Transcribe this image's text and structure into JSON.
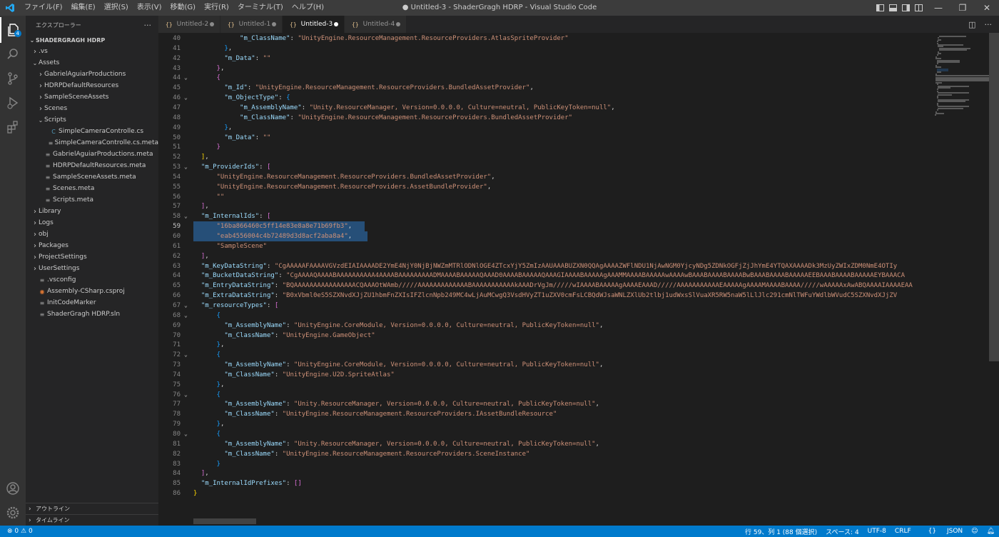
{
  "menu": [
    "ファイル(F)",
    "編集(E)",
    "選択(S)",
    "表示(V)",
    "移動(G)",
    "実行(R)",
    "ターミナル(T)",
    "ヘルプ(H)"
  ],
  "window_title": "● Untitled-3 - ShaderGragh HDRP - Visual Studio Code",
  "activity": {
    "explorer_badge": "4"
  },
  "sidebar": {
    "title": "エクスプローラー",
    "more": "···",
    "workspace": "SHADERGRAGH HDRP",
    "tree": [
      {
        "label": ".vs",
        "depth": 0,
        "kind": "folder",
        "open": false
      },
      {
        "label": "Assets",
        "depth": 0,
        "kind": "folder",
        "open": true
      },
      {
        "label": "GabrielAguiarProductions",
        "depth": 1,
        "kind": "folder",
        "open": false
      },
      {
        "label": "HDRPDefaultResources",
        "depth": 1,
        "kind": "folder",
        "open": false
      },
      {
        "label": "SampleSceneAssets",
        "depth": 1,
        "kind": "folder",
        "open": false
      },
      {
        "label": "Scenes",
        "depth": 1,
        "kind": "folder",
        "open": false
      },
      {
        "label": "Scripts",
        "depth": 1,
        "kind": "folder",
        "open": true
      },
      {
        "label": "SimpleCameraControlle.cs",
        "depth": 2,
        "kind": "cs"
      },
      {
        "label": "SimpleCameraControlle.cs.meta",
        "depth": 2,
        "kind": "meta"
      },
      {
        "label": "GabrielAguiarProductions.meta",
        "depth": 1,
        "kind": "meta"
      },
      {
        "label": "HDRPDefaultResources.meta",
        "depth": 1,
        "kind": "meta"
      },
      {
        "label": "SampleSceneAssets.meta",
        "depth": 1,
        "kind": "meta"
      },
      {
        "label": "Scenes.meta",
        "depth": 1,
        "kind": "meta"
      },
      {
        "label": "Scripts.meta",
        "depth": 1,
        "kind": "meta"
      },
      {
        "label": "Library",
        "depth": 0,
        "kind": "folder",
        "open": false
      },
      {
        "label": "Logs",
        "depth": 0,
        "kind": "folder",
        "open": false
      },
      {
        "label": "obj",
        "depth": 0,
        "kind": "folder",
        "open": false
      },
      {
        "label": "Packages",
        "depth": 0,
        "kind": "folder",
        "open": false
      },
      {
        "label": "ProjectSettings",
        "depth": 0,
        "kind": "folder",
        "open": false
      },
      {
        "label": "UserSettings",
        "depth": 0,
        "kind": "folder",
        "open": false
      },
      {
        "label": ".vsconfig",
        "depth": 0,
        "kind": "meta"
      },
      {
        "label": "Assembly-CSharp.csproj",
        "depth": 0,
        "kind": "rss"
      },
      {
        "label": "InitCodeMarker",
        "depth": 0,
        "kind": "meta"
      },
      {
        "label": "ShaderGragh HDRP.sln",
        "depth": 0,
        "kind": "meta"
      }
    ],
    "outline": "アウトライン",
    "timeline": "タイムライン"
  },
  "tabs": [
    {
      "label": "Untitled-2",
      "active": false
    },
    {
      "label": "Untitled-1",
      "active": false
    },
    {
      "label": "Untitled-3",
      "active": true
    },
    {
      "label": "Untitled-4",
      "active": false
    }
  ],
  "editor": {
    "lines": [
      {
        "n": "40",
        "fold": "",
        "t": [
          [
            "            ",
            "p"
          ],
          [
            "\"m_ClassName\"",
            "k"
          ],
          [
            ": ",
            "p"
          ],
          [
            "\"UnityEngine.ResourceManagement.ResourceProviders.AtlasSpriteProvider\"",
            "s"
          ]
        ]
      },
      {
        "n": "41",
        "fold": "",
        "t": [
          [
            "        ",
            "p"
          ],
          [
            "}",
            "b3"
          ],
          [
            ",",
            "p"
          ]
        ]
      },
      {
        "n": "42",
        "fold": "",
        "t": [
          [
            "        ",
            "p"
          ],
          [
            "\"m_Data\"",
            "k"
          ],
          [
            ": ",
            "p"
          ],
          [
            "\"\"",
            "s"
          ]
        ]
      },
      {
        "n": "43",
        "fold": "",
        "t": [
          [
            "      ",
            "p"
          ],
          [
            "}",
            "b2"
          ],
          [
            ",",
            "p"
          ]
        ]
      },
      {
        "n": "44",
        "fold": "v",
        "t": [
          [
            "      ",
            "p"
          ],
          [
            "{",
            "b2"
          ]
        ]
      },
      {
        "n": "45",
        "fold": "",
        "t": [
          [
            "        ",
            "p"
          ],
          [
            "\"m_Id\"",
            "k"
          ],
          [
            ": ",
            "p"
          ],
          [
            "\"UnityEngine.ResourceManagement.ResourceProviders.BundledAssetProvider\"",
            "s"
          ],
          [
            ",",
            "p"
          ]
        ]
      },
      {
        "n": "46",
        "fold": "v",
        "t": [
          [
            "        ",
            "p"
          ],
          [
            "\"m_ObjectType\"",
            "k"
          ],
          [
            ": ",
            "p"
          ],
          [
            "{",
            "b3"
          ]
        ]
      },
      {
        "n": "47",
        "fold": "",
        "t": [
          [
            "            ",
            "p"
          ],
          [
            "\"m_AssemblyName\"",
            "k"
          ],
          [
            ": ",
            "p"
          ],
          [
            "\"Unity.ResourceManager, Version=0.0.0.0, Culture=neutral, PublicKeyToken=null\"",
            "s"
          ],
          [
            ",",
            "p"
          ]
        ]
      },
      {
        "n": "48",
        "fold": "",
        "t": [
          [
            "            ",
            "p"
          ],
          [
            "\"m_ClassName\"",
            "k"
          ],
          [
            ": ",
            "p"
          ],
          [
            "\"UnityEngine.ResourceManagement.ResourceProviders.BundledAssetProvider\"",
            "s"
          ]
        ]
      },
      {
        "n": "49",
        "fold": "",
        "t": [
          [
            "        ",
            "p"
          ],
          [
            "}",
            "b3"
          ],
          [
            ",",
            "p"
          ]
        ]
      },
      {
        "n": "50",
        "fold": "",
        "t": [
          [
            "        ",
            "p"
          ],
          [
            "\"m_Data\"",
            "k"
          ],
          [
            ": ",
            "p"
          ],
          [
            "\"\"",
            "s"
          ]
        ]
      },
      {
        "n": "51",
        "fold": "",
        "t": [
          [
            "      ",
            "p"
          ],
          [
            "}",
            "b2"
          ]
        ]
      },
      {
        "n": "52",
        "fold": "",
        "t": [
          [
            "  ",
            "p"
          ],
          [
            "]",
            "b1"
          ],
          [
            ",",
            "p"
          ]
        ]
      },
      {
        "n": "53",
        "fold": "v",
        "t": [
          [
            "  ",
            "p"
          ],
          [
            "\"m_ProviderIds\"",
            "k"
          ],
          [
            ": ",
            "p"
          ],
          [
            "[",
            "b2"
          ]
        ]
      },
      {
        "n": "54",
        "fold": "",
        "t": [
          [
            "      ",
            "p"
          ],
          [
            "\"UnityEngine.ResourceManagement.ResourceProviders.BundledAssetProvider\"",
            "s"
          ],
          [
            ",",
            "p"
          ]
        ]
      },
      {
        "n": "55",
        "fold": "",
        "t": [
          [
            "      ",
            "p"
          ],
          [
            "\"UnityEngine.ResourceManagement.ResourceProviders.AssetBundleProvider\"",
            "s"
          ],
          [
            ",",
            "p"
          ]
        ]
      },
      {
        "n": "56",
        "fold": "",
        "t": [
          [
            "      ",
            "p"
          ],
          [
            "\"\"",
            "s"
          ]
        ]
      },
      {
        "n": "57",
        "fold": "",
        "t": [
          [
            "  ",
            "p"
          ],
          [
            "]",
            "b2"
          ],
          [
            ",",
            "p"
          ]
        ]
      },
      {
        "n": "58",
        "fold": "v",
        "t": [
          [
            "  ",
            "p"
          ],
          [
            "\"m_InternalIds\"",
            "k"
          ],
          [
            ": ",
            "p"
          ],
          [
            "[",
            "b2"
          ]
        ]
      },
      {
        "n": "59",
        "fold": "",
        "sel": true,
        "cur": true,
        "t": [
          [
            "      ",
            "p"
          ],
          [
            "\"16ba866460c5ff14e83e8a8e71b69fb3\"",
            "s"
          ],
          [
            ",",
            "p"
          ]
        ]
      },
      {
        "n": "60",
        "fold": "",
        "sel": true,
        "t": [
          [
            "      ",
            "p"
          ],
          [
            "\"eab4556004c4b72489d3d8acf2aba8a4\"",
            "s"
          ],
          [
            ",",
            "p"
          ]
        ]
      },
      {
        "n": "61",
        "fold": "",
        "t": [
          [
            "      ",
            "p"
          ],
          [
            "\"SampleScene\"",
            "s"
          ]
        ]
      },
      {
        "n": "62",
        "fold": "",
        "t": [
          [
            "  ",
            "p"
          ],
          [
            "]",
            "b2"
          ],
          [
            ",",
            "p"
          ]
        ]
      },
      {
        "n": "63",
        "fold": "",
        "t": [
          [
            "  ",
            "p"
          ],
          [
            "\"m_KeyDataString\"",
            "k"
          ],
          [
            ": ",
            "p"
          ],
          [
            "\"CgAAAAAFAAAAVGVzdEIAIAAAADE2YmE4NjY0NjBjNWZmMTRlODNlOGE4ZTcxYjY5ZmIzAAUAAABUZXN0QQAgAAAAZWFlNDU1NjAwNGM0YjcyNDg5ZDNkOGFjZjJhYmE4YTQAXAAAADk3MzUyZWIxZDM0NmE4OTIy",
            "s"
          ]
        ]
      },
      {
        "n": "64",
        "fold": "",
        "t": [
          [
            "  ",
            "p"
          ],
          [
            "\"m_BucketDataString\"",
            "k"
          ],
          [
            ": ",
            "p"
          ],
          [
            "\"CgAAAAQAAAABAAAAAAAAAA4AAAABAAAAAAAAADMAAAABAAAAAQAAAD0AAAABAAAAAQAAAGIAAAABAAAAAgAAAMMAAAABAAAAAwAAAAwBAAABAAAABAAAABwBAAABAAAABAAAAAEEBAAABAAAABAAAAAEYBAAACA",
            "s"
          ]
        ]
      },
      {
        "n": "65",
        "fold": "",
        "t": [
          [
            "  ",
            "p"
          ],
          [
            "\"m_EntryDataString\"",
            "k"
          ],
          [
            ": ",
            "p"
          ],
          [
            "\"BQAAAAAAAAAAAAAAAACQAAAOtWAmb/////AAAAAAAAAAAAABAAAAAAAAAAAkAAADrVgJm/////wIAAAABAAAAAgAAAAEAAAD/////AAAAAAAAAAAEAAAAAgAAAAMAAAABAAAA/////wAAAAAxAwABQAAAAIAAAAEAA",
            "s"
          ]
        ]
      },
      {
        "n": "66",
        "fold": "",
        "t": [
          [
            "  ",
            "p"
          ],
          [
            "\"m_ExtraDataString\"",
            "k"
          ],
          [
            ": ",
            "p"
          ],
          [
            "\"B0xVbml0eS5SZXNvdXJjZU1hbmFnZXIsIFZlcnNpb249MC4wLjAuMCwgQ3VsdHVyZT1uZXV0cmFsLCBQdWJsaWNLZXlUb2tlbj1udWxsSlVuaXR5RW5naW5lLlJlc291cmNlTWFuYWdlbWVudC5SZXNvdXJjZV",
            "s"
          ]
        ]
      },
      {
        "n": "67",
        "fold": "v",
        "t": [
          [
            "  ",
            "p"
          ],
          [
            "\"m_resourceTypes\"",
            "k"
          ],
          [
            ": ",
            "p"
          ],
          [
            "[",
            "b2"
          ]
        ]
      },
      {
        "n": "68",
        "fold": "v",
        "t": [
          [
            "      ",
            "p"
          ],
          [
            "{",
            "b3"
          ]
        ]
      },
      {
        "n": "69",
        "fold": "",
        "t": [
          [
            "        ",
            "p"
          ],
          [
            "\"m_AssemblyName\"",
            "k"
          ],
          [
            ": ",
            "p"
          ],
          [
            "\"UnityEngine.CoreModule, Version=0.0.0.0, Culture=neutral, PublicKeyToken=null\"",
            "s"
          ],
          [
            ",",
            "p"
          ]
        ]
      },
      {
        "n": "70",
        "fold": "",
        "t": [
          [
            "        ",
            "p"
          ],
          [
            "\"m_ClassName\"",
            "k"
          ],
          [
            ": ",
            "p"
          ],
          [
            "\"UnityEngine.GameObject\"",
            "s"
          ]
        ]
      },
      {
        "n": "71",
        "fold": "",
        "t": [
          [
            "      ",
            "p"
          ],
          [
            "}",
            "b3"
          ],
          [
            ",",
            "p"
          ]
        ]
      },
      {
        "n": "72",
        "fold": "v",
        "t": [
          [
            "      ",
            "p"
          ],
          [
            "{",
            "b3"
          ]
        ]
      },
      {
        "n": "73",
        "fold": "",
        "t": [
          [
            "        ",
            "p"
          ],
          [
            "\"m_AssemblyName\"",
            "k"
          ],
          [
            ": ",
            "p"
          ],
          [
            "\"UnityEngine.CoreModule, Version=0.0.0.0, Culture=neutral, PublicKeyToken=null\"",
            "s"
          ],
          [
            ",",
            "p"
          ]
        ]
      },
      {
        "n": "74",
        "fold": "",
        "t": [
          [
            "        ",
            "p"
          ],
          [
            "\"m_ClassName\"",
            "k"
          ],
          [
            ": ",
            "p"
          ],
          [
            "\"UnityEngine.U2D.SpriteAtlas\"",
            "s"
          ]
        ]
      },
      {
        "n": "75",
        "fold": "",
        "t": [
          [
            "      ",
            "p"
          ],
          [
            "}",
            "b3"
          ],
          [
            ",",
            "p"
          ]
        ]
      },
      {
        "n": "76",
        "fold": "v",
        "t": [
          [
            "      ",
            "p"
          ],
          [
            "{",
            "b3"
          ]
        ]
      },
      {
        "n": "77",
        "fold": "",
        "t": [
          [
            "        ",
            "p"
          ],
          [
            "\"m_AssemblyName\"",
            "k"
          ],
          [
            ": ",
            "p"
          ],
          [
            "\"Unity.ResourceManager, Version=0.0.0.0, Culture=neutral, PublicKeyToken=null\"",
            "s"
          ],
          [
            ",",
            "p"
          ]
        ]
      },
      {
        "n": "78",
        "fold": "",
        "t": [
          [
            "        ",
            "p"
          ],
          [
            "\"m_ClassName\"",
            "k"
          ],
          [
            ": ",
            "p"
          ],
          [
            "\"UnityEngine.ResourceManagement.ResourceProviders.IAssetBundleResource\"",
            "s"
          ]
        ]
      },
      {
        "n": "79",
        "fold": "",
        "t": [
          [
            "      ",
            "p"
          ],
          [
            "}",
            "b3"
          ],
          [
            ",",
            "p"
          ]
        ]
      },
      {
        "n": "80",
        "fold": "v",
        "t": [
          [
            "      ",
            "p"
          ],
          [
            "{",
            "b3"
          ]
        ]
      },
      {
        "n": "81",
        "fold": "",
        "t": [
          [
            "        ",
            "p"
          ],
          [
            "\"m_AssemblyName\"",
            "k"
          ],
          [
            ": ",
            "p"
          ],
          [
            "\"Unity.ResourceManager, Version=0.0.0.0, Culture=neutral, PublicKeyToken=null\"",
            "s"
          ],
          [
            ",",
            "p"
          ]
        ]
      },
      {
        "n": "82",
        "fold": "",
        "t": [
          [
            "        ",
            "p"
          ],
          [
            "\"m_ClassName\"",
            "k"
          ],
          [
            ": ",
            "p"
          ],
          [
            "\"UnityEngine.ResourceManagement.ResourceProviders.SceneInstance\"",
            "s"
          ]
        ]
      },
      {
        "n": "83",
        "fold": "",
        "t": [
          [
            "      ",
            "p"
          ],
          [
            "}",
            "b3"
          ]
        ]
      },
      {
        "n": "84",
        "fold": "",
        "t": [
          [
            "  ",
            "p"
          ],
          [
            "]",
            "b2"
          ],
          [
            ",",
            "p"
          ]
        ]
      },
      {
        "n": "85",
        "fold": "",
        "t": [
          [
            "  ",
            "p"
          ],
          [
            "\"m_InternalIdPrefixes\"",
            "k"
          ],
          [
            ": ",
            "p"
          ],
          [
            "[]",
            "b2"
          ]
        ]
      },
      {
        "n": "86",
        "fold": "",
        "t": [
          [
            "",
            "p"
          ],
          [
            "}",
            "b1"
          ]
        ]
      }
    ]
  },
  "status": {
    "errors": "0",
    "warnings": "0",
    "position": "行 59、列 1 (88 個選択)",
    "spaces": "スペース: 4",
    "encoding": "UTF-8",
    "eol": "CRLF",
    "language": "JSON"
  }
}
